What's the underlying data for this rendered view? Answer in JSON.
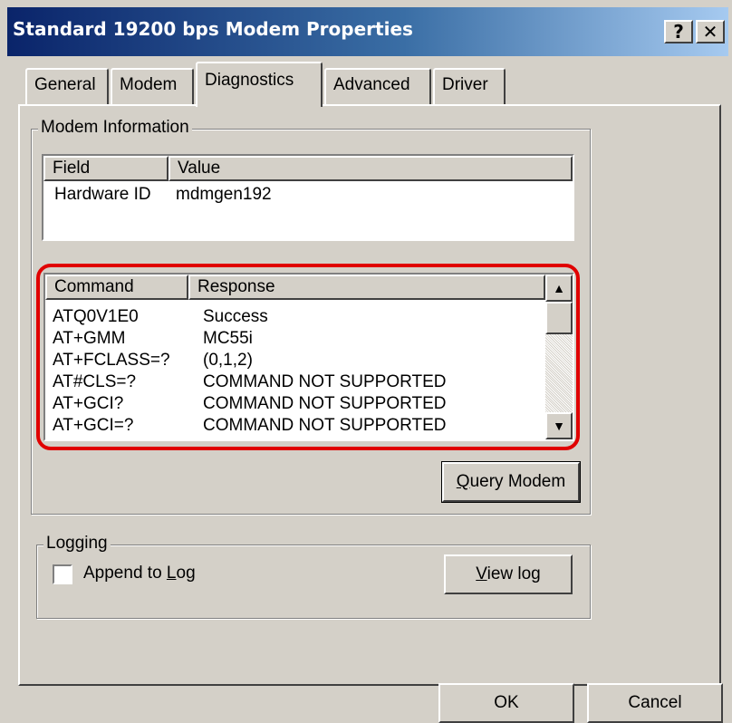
{
  "window": {
    "title": "Standard 19200 bps Modem Properties",
    "help_label": "?",
    "close_label": "✕"
  },
  "tabs": [
    {
      "label": "General"
    },
    {
      "label": "Modem"
    },
    {
      "label": "Diagnostics",
      "active": true
    },
    {
      "label": "Advanced"
    },
    {
      "label": "Driver"
    }
  ],
  "modem_info": {
    "group_label": "Modem Information",
    "columns": [
      "Field",
      "Value"
    ],
    "rows": [
      {
        "field": "Hardware ID",
        "value": "mdmgen192"
      }
    ]
  },
  "commands": {
    "columns": [
      "Command",
      "Response"
    ],
    "rows": [
      {
        "command": "ATQ0V1E0",
        "response": "Success"
      },
      {
        "command": "AT+GMM",
        "response": "MC55i"
      },
      {
        "command": "AT+FCLASS=?",
        "response": "(0,1,2)"
      },
      {
        "command": "AT#CLS=?",
        "response": "COMMAND NOT SUPPORTED"
      },
      {
        "command": "AT+GCI?",
        "response": "COMMAND NOT SUPPORTED"
      },
      {
        "command": "AT+GCI=?",
        "response": "COMMAND NOT SUPPORTED"
      }
    ],
    "scroll_up_icon": "triangle-up-icon",
    "scroll_down_icon": "triangle-down-icon",
    "highlight_color": "#e00000"
  },
  "query_button": {
    "mnemonic": "Q",
    "rest": "uery Modem"
  },
  "logging": {
    "group_label": "Logging",
    "checkbox_label_pre": "Append to ",
    "checkbox_mnemonic": "L",
    "checkbox_label_post": "og",
    "checked": false,
    "view_log_mnemonic": "V",
    "view_log_rest": "iew log"
  },
  "footer": {
    "ok_label": "OK",
    "cancel_label": "Cancel"
  },
  "colors": {
    "title_gradient_start": "#0a246a",
    "title_gradient_end": "#a6caf0",
    "face": "#d4d0c8"
  }
}
